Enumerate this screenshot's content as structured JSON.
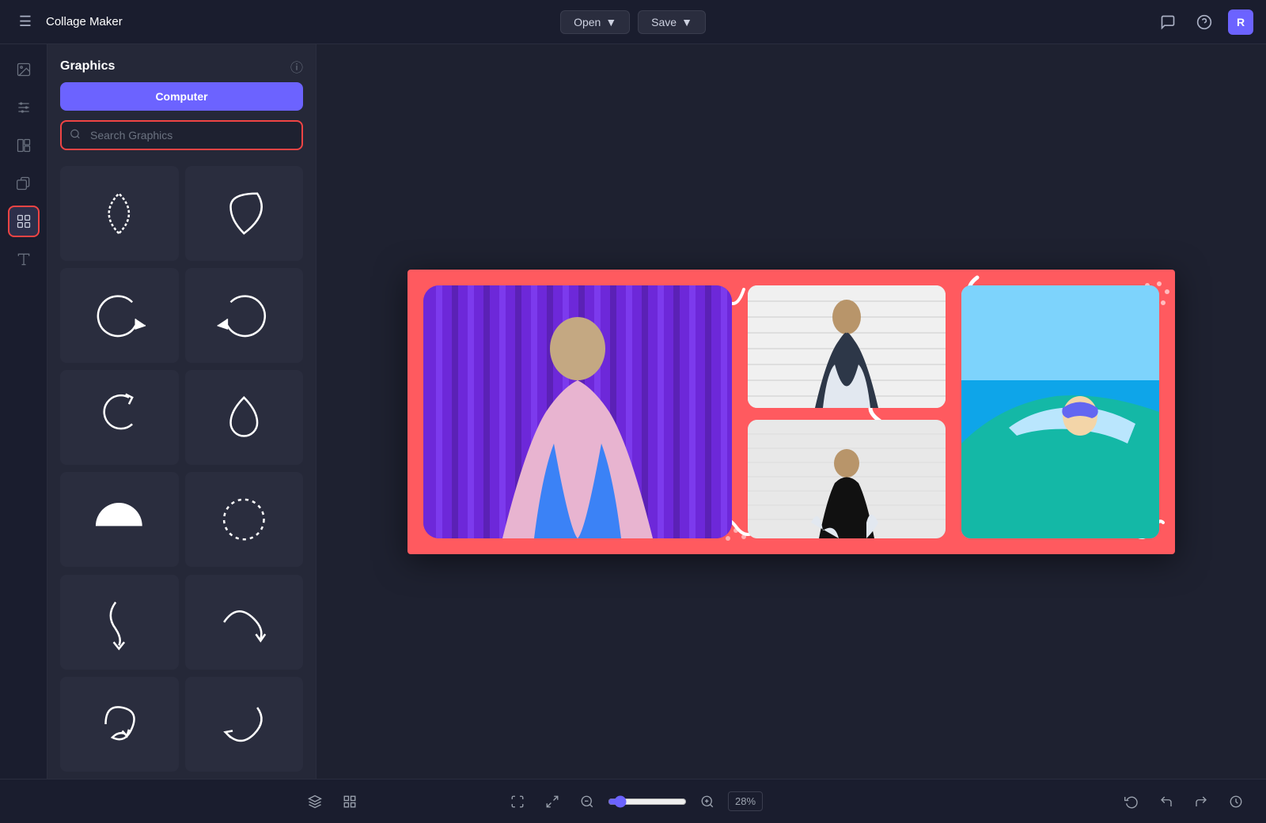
{
  "app": {
    "title": "Collage Maker"
  },
  "topbar": {
    "open_label": "Open",
    "save_label": "Save",
    "avatar_letter": "R"
  },
  "panel": {
    "title": "Graphics",
    "upload_label": "Computer",
    "search_placeholder": "Search Graphics"
  },
  "zoom": {
    "value": 28,
    "label": "28%"
  },
  "sidebar_icons": [
    {
      "name": "photos-icon",
      "label": "Photos"
    },
    {
      "name": "filters-icon",
      "label": "Filters"
    },
    {
      "name": "layouts-icon",
      "label": "Layouts"
    },
    {
      "name": "overlays-icon",
      "label": "Overlays"
    },
    {
      "name": "graphics-icon",
      "label": "Graphics"
    },
    {
      "name": "text-icon",
      "label": "Text"
    }
  ]
}
